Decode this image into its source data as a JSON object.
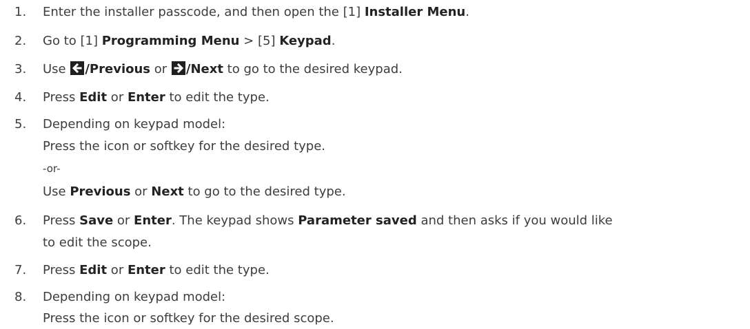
{
  "steps": [
    {
      "num": "1.",
      "a": "Enter the installer passcode, and then open the [1] ",
      "b": "Installer Menu",
      "c": "."
    },
    {
      "num": "2.",
      "a": "Go to [1] ",
      "b": "Programming Menu",
      "c": " > [5] ",
      "d": "Keypad",
      "e": "."
    },
    {
      "num": "3.",
      "a": "Use ",
      "b": "/Previous",
      "c": " or ",
      "d": "/Next",
      "e": " to go to the desired keypad."
    },
    {
      "num": "4.",
      "a": "Press ",
      "b": "Edit",
      "c": " or ",
      "d": "Enter",
      "e": " to edit the type."
    },
    {
      "num": "5.",
      "a": "Depending on keypad model:",
      "line2": "Press the icon or softkey for the desired type.",
      "line3": "-or-",
      "line4a": "Use ",
      "line4b": "Previous",
      "line4c": " or ",
      "line4d": "Next",
      "line4e": " to go to the desired type."
    },
    {
      "num": "6.",
      "a": "Press ",
      "b": "Save",
      "c": " or ",
      "d": "Enter",
      "e": ". The keypad shows ",
      "f": "Parameter saved",
      "g": " and then asks if you would like",
      "line2": "to edit the scope."
    },
    {
      "num": "7.",
      "a": "Press ",
      "b": "Edit",
      "c": " or ",
      "d": "Enter",
      "e": " to edit the type."
    },
    {
      "num": "8.",
      "a": "Depending on keypad model:",
      "line2": "Press the icon or softkey for the desired scope."
    }
  ],
  "icons": {
    "previous": "left-arrow-key-icon",
    "next": "right-arrow-key-icon"
  }
}
